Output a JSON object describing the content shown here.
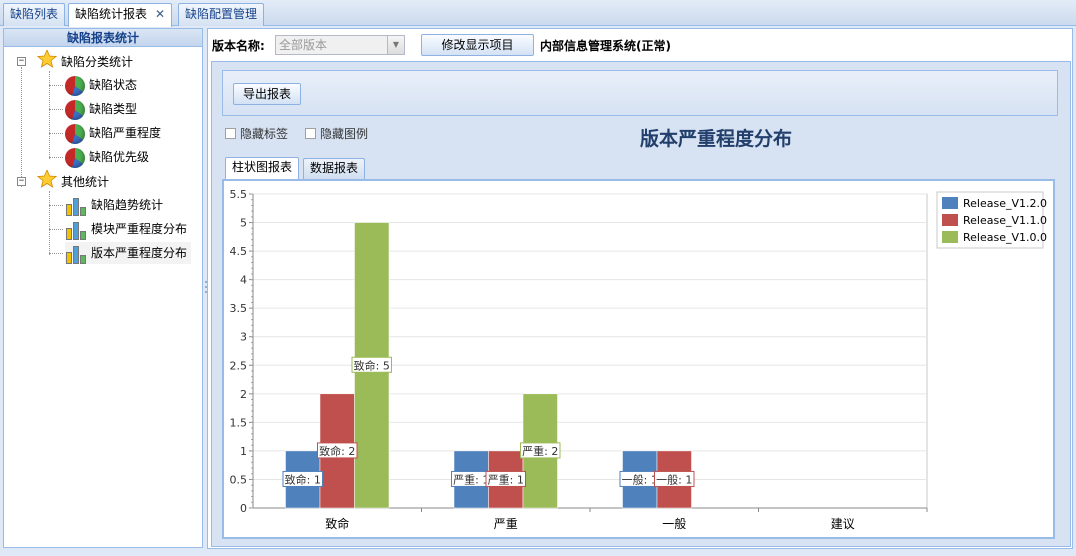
{
  "top_tabs": [
    {
      "label": "缺陷列表"
    },
    {
      "label": "缺陷统计报表",
      "closable": true
    },
    {
      "label": "缺陷配置管理"
    }
  ],
  "sidebar": {
    "title": "缺陷报表统计",
    "groups": [
      {
        "label": "缺陷分类统计",
        "items": [
          "缺陷状态",
          "缺陷类型",
          "缺陷严重程度",
          "缺陷优先级"
        ]
      },
      {
        "label": "其他统计",
        "items": [
          "缺陷趋势统计",
          "模块严重程度分布",
          "版本严重程度分布"
        ]
      }
    ]
  },
  "header": {
    "version_label": "版本名称:",
    "version_placeholder": "全部版本",
    "modify_button": "修改显示项目",
    "system_name": "内部信息管理系统(正常)"
  },
  "toolbar": {
    "export_button": "导出报表",
    "hide_labels": "隐藏标签",
    "hide_legend": "隐藏图例",
    "report_title": "版本严重程度分布"
  },
  "subtabs": [
    "柱状图报表",
    "数据报表"
  ],
  "chart_data": {
    "type": "bar",
    "categories": [
      "致命",
      "严重",
      "一般",
      "建议"
    ],
    "ylim": [
      0,
      5.5
    ],
    "yticks": [
      0,
      0.5,
      1,
      1.5,
      2,
      2.5,
      3,
      3.5,
      4,
      4.5,
      5,
      5.5
    ],
    "legend_position": "top-right",
    "grid": true,
    "series": [
      {
        "name": "Release_V1.2.0",
        "color": "#4f81bd",
        "values": [
          1,
          1,
          1,
          0
        ]
      },
      {
        "name": "Release_V1.1.0",
        "color": "#c0504d",
        "values": [
          2,
          1,
          1,
          0
        ]
      },
      {
        "name": "Release_V1.0.0",
        "color": "#9bbb59",
        "values": [
          5,
          2,
          0,
          0
        ]
      }
    ],
    "data_labels": [
      {
        "category": 0,
        "series": 0,
        "text": "致命: 1"
      },
      {
        "category": 0,
        "series": 1,
        "text": "致命: 2"
      },
      {
        "category": 0,
        "series": 2,
        "text": "致命: 5"
      },
      {
        "category": 1,
        "series": 0,
        "text": "严重: 1"
      },
      {
        "category": 1,
        "series": 1,
        "text": "严重: 1"
      },
      {
        "category": 1,
        "series": 2,
        "text": "严重: 2"
      },
      {
        "category": 2,
        "series": 0,
        "text": "一般: 1"
      },
      {
        "category": 2,
        "series": 1,
        "text": "一般: 1"
      }
    ]
  }
}
